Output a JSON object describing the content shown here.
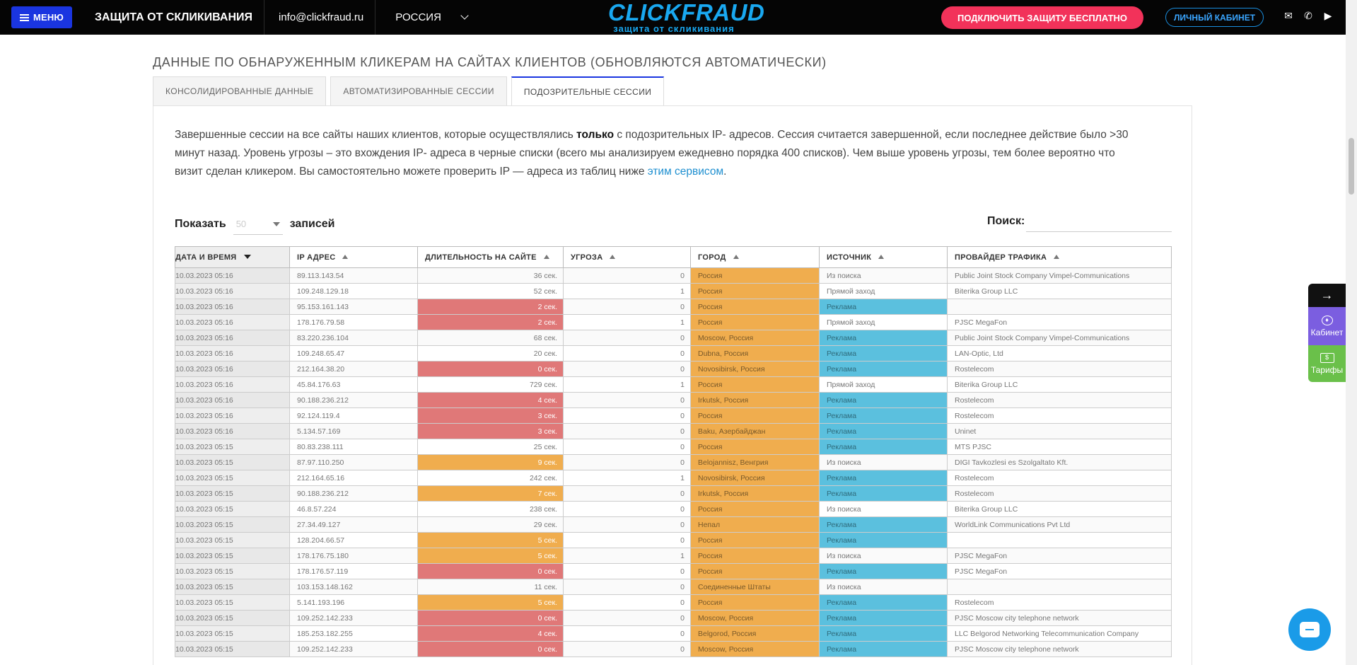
{
  "header": {
    "menu_label": "МЕНЮ",
    "title": "ЗАЩИТА ОТ СКЛИКИВАНИЯ",
    "email": "info@clickfraud.ru",
    "region": "РОССИЯ",
    "logo_main": "CLICKFRAUD",
    "logo_sub": "защита от скликивания",
    "cta": "ПОДКЛЮЧИТЬ ЗАЩИТУ БЕСПЛАТНО",
    "cabinet": "ЛИЧНЫЙ КАБИНЕТ"
  },
  "section": {
    "title": "ДАННЫЕ ПО ОБНАРУЖЕННЫМ КЛИКЕРАМ НА САЙТАХ КЛИЕНТОВ (ОБНОВЛЯЮТСЯ АВТОМАТИЧЕСКИ)",
    "tabs": [
      {
        "label": "КОНСОЛИДИРОВАННЫЕ ДАННЫЕ"
      },
      {
        "label": "АВТОМАТИЗИРОВАННЫЕ СЕССИИ"
      },
      {
        "label": "ПОДОЗРИТЕЛЬНЫЕ СЕССИИ"
      }
    ],
    "desc_1": "Завершенные сессии на все сайты наших клиентов, которые осуществлялись ",
    "desc_bold": "только",
    "desc_2": " с подозрительных IP- адресов. Сессия считается завершенной, если последнее действие было >30 минут назад. Уровень угрозы – это вхождения IP- адреса в черные списки (всего мы анализируем ежедневно порядка 400 списков). Чем выше уровень угрозы, тем более вероятно что визит сделан кликером. Вы самостоятельно можете проверить IP — адреса из таблиц ниже ",
    "desc_link": "этим сервисом",
    "desc_end": "."
  },
  "controls": {
    "show_label": "Показать",
    "show_value": "50",
    "records_label": "записей",
    "search_label": "Поиск:"
  },
  "table": {
    "headers": [
      "ДАТА И ВРЕМЯ",
      "IP АДРЕС",
      "ДЛИТЕЛЬНОСТЬ НА САЙТЕ",
      "УГРОЗА",
      "ГОРОД",
      "ИСТОЧНИК",
      "ПРОВАЙДЕР ТРАФИКА"
    ],
    "rows": [
      {
        "dt": "10.03.2023 05:16",
        "ip": "89.113.143.54",
        "dur": "36 сек.",
        "dc": "",
        "threat": "0",
        "city": "Россия",
        "src": "Из поиска",
        "sc": "",
        "prov": "Public Joint Stock Company Vimpel-Communications"
      },
      {
        "dt": "10.03.2023 05:16",
        "ip": "109.248.129.18",
        "dur": "52 сек.",
        "dc": "",
        "threat": "1",
        "city": "Россия",
        "src": "Прямой заход",
        "sc": "",
        "prov": "Biterika Group LLC"
      },
      {
        "dt": "10.03.2023 05:16",
        "ip": "95.153.161.143",
        "dur": "2 сек.",
        "dc": "red",
        "threat": "0",
        "city": "Россия",
        "src": "Реклама",
        "sc": "blue",
        "prov": ""
      },
      {
        "dt": "10.03.2023 05:16",
        "ip": "178.176.79.58",
        "dur": "2 сек.",
        "dc": "red",
        "threat": "1",
        "city": "Россия",
        "src": "Прямой заход",
        "sc": "",
        "prov": "PJSC MegaFon"
      },
      {
        "dt": "10.03.2023 05:16",
        "ip": "83.220.236.104",
        "dur": "68 сек.",
        "dc": "",
        "threat": "0",
        "city": "Moscow, Россия",
        "src": "Реклама",
        "sc": "blue",
        "prov": "Public Joint Stock Company Vimpel-Communications"
      },
      {
        "dt": "10.03.2023 05:16",
        "ip": "109.248.65.47",
        "dur": "20 сек.",
        "dc": "",
        "threat": "0",
        "city": "Dubna, Россия",
        "src": "Реклама",
        "sc": "blue",
        "prov": "LAN-Optic, Ltd"
      },
      {
        "dt": "10.03.2023 05:16",
        "ip": "212.164.38.20",
        "dur": "0 сек.",
        "dc": "red",
        "threat": "0",
        "city": "Novosibirsk, Россия",
        "src": "Реклама",
        "sc": "blue",
        "prov": "Rostelecom"
      },
      {
        "dt": "10.03.2023 05:16",
        "ip": "45.84.176.63",
        "dur": "729 сек.",
        "dc": "",
        "threat": "1",
        "city": "Россия",
        "src": "Прямой заход",
        "sc": "",
        "prov": "Biterika Group LLC"
      },
      {
        "dt": "10.03.2023 05:16",
        "ip": "90.188.236.212",
        "dur": "4 сек.",
        "dc": "red",
        "threat": "0",
        "city": "Irkutsk, Россия",
        "src": "Реклама",
        "sc": "blue",
        "prov": "Rostelecom"
      },
      {
        "dt": "10.03.2023 05:16",
        "ip": "92.124.119.4",
        "dur": "3 сек.",
        "dc": "red",
        "threat": "0",
        "city": "Россия",
        "src": "Реклама",
        "sc": "blue",
        "prov": "Rostelecom"
      },
      {
        "dt": "10.03.2023 05:16",
        "ip": "5.134.57.169",
        "dur": "3 сек.",
        "dc": "red",
        "threat": "0",
        "city": "Baku, Азербайджан",
        "src": "Реклама",
        "sc": "blue",
        "prov": "Uninet"
      },
      {
        "dt": "10.03.2023 05:15",
        "ip": "80.83.238.111",
        "dur": "25 сек.",
        "dc": "",
        "threat": "0",
        "city": "Россия",
        "src": "Реклама",
        "sc": "blue",
        "prov": "MTS PJSC"
      },
      {
        "dt": "10.03.2023 05:15",
        "ip": "87.97.110.250",
        "dur": "9 сек.",
        "dc": "orange",
        "threat": "0",
        "city": "Belojannisz, Венгрия",
        "src": "Из поиска",
        "sc": "",
        "prov": "DIGI Tavkozlesi es Szolgaltato Kft."
      },
      {
        "dt": "10.03.2023 05:15",
        "ip": "212.164.65.16",
        "dur": "242 сек.",
        "dc": "",
        "threat": "1",
        "city": "Novosibirsk, Россия",
        "src": "Реклама",
        "sc": "blue",
        "prov": "Rostelecom"
      },
      {
        "dt": "10.03.2023 05:15",
        "ip": "90.188.236.212",
        "dur": "7 сек.",
        "dc": "orange",
        "threat": "0",
        "city": "Irkutsk, Россия",
        "src": "Реклама",
        "sc": "blue",
        "prov": "Rostelecom"
      },
      {
        "dt": "10.03.2023 05:15",
        "ip": "46.8.57.224",
        "dur": "238 сек.",
        "dc": "",
        "threat": "0",
        "city": "Россия",
        "src": "Из поиска",
        "sc": "",
        "prov": "Biterika Group LLC"
      },
      {
        "dt": "10.03.2023 05:15",
        "ip": "27.34.49.127",
        "dur": "29 сек.",
        "dc": "",
        "threat": "0",
        "city": "Непал",
        "src": "Реклама",
        "sc": "blue",
        "prov": "WorldLink Communications Pvt Ltd"
      },
      {
        "dt": "10.03.2023 05:15",
        "ip": "128.204.66.57",
        "dur": "5 сек.",
        "dc": "orange",
        "threat": "0",
        "city": "Россия",
        "src": "Реклама",
        "sc": "blue",
        "prov": ""
      },
      {
        "dt": "10.03.2023 05:15",
        "ip": "178.176.75.180",
        "dur": "5 сек.",
        "dc": "orange",
        "threat": "1",
        "city": "Россия",
        "src": "Из поиска",
        "sc": "",
        "prov": "PJSC MegaFon"
      },
      {
        "dt": "10.03.2023 05:15",
        "ip": "178.176.57.119",
        "dur": "0 сек.",
        "dc": "red",
        "threat": "0",
        "city": "Россия",
        "src": "Реклама",
        "sc": "blue",
        "prov": "PJSC MegaFon"
      },
      {
        "dt": "10.03.2023 05:15",
        "ip": "103.153.148.162",
        "dur": "11 сек.",
        "dc": "",
        "threat": "0",
        "city": "Соединенные Штаты",
        "src": "Из поиска",
        "sc": "",
        "prov": ""
      },
      {
        "dt": "10.03.2023 05:15",
        "ip": "5.141.193.196",
        "dur": "5 сек.",
        "dc": "orange",
        "threat": "0",
        "city": "Россия",
        "src": "Реклама",
        "sc": "blue",
        "prov": "Rostelecom"
      },
      {
        "dt": "10.03.2023 05:15",
        "ip": "109.252.142.233",
        "dur": "0 сек.",
        "dc": "red",
        "threat": "0",
        "city": "Moscow, Россия",
        "src": "Реклама",
        "sc": "blue",
        "prov": "PJSC Moscow city telephone network"
      },
      {
        "dt": "10.03.2023 05:15",
        "ip": "185.253.182.255",
        "dur": "4 сек.",
        "dc": "red",
        "threat": "0",
        "city": "Belgorod, Россия",
        "src": "Реклама",
        "sc": "blue",
        "prov": "LLC Belgorod Networking Telecommunication Company"
      },
      {
        "dt": "10.03.2023 05:15",
        "ip": "109.252.142.233",
        "dur": "0 сек.",
        "dc": "red",
        "threat": "0",
        "city": "Moscow, Россия",
        "src": "Реклама",
        "sc": "blue",
        "prov": "PJSC Moscow city telephone network"
      }
    ]
  },
  "side_widget": {
    "kab_label": "Кабинет",
    "tar_label": "Тарифы"
  }
}
